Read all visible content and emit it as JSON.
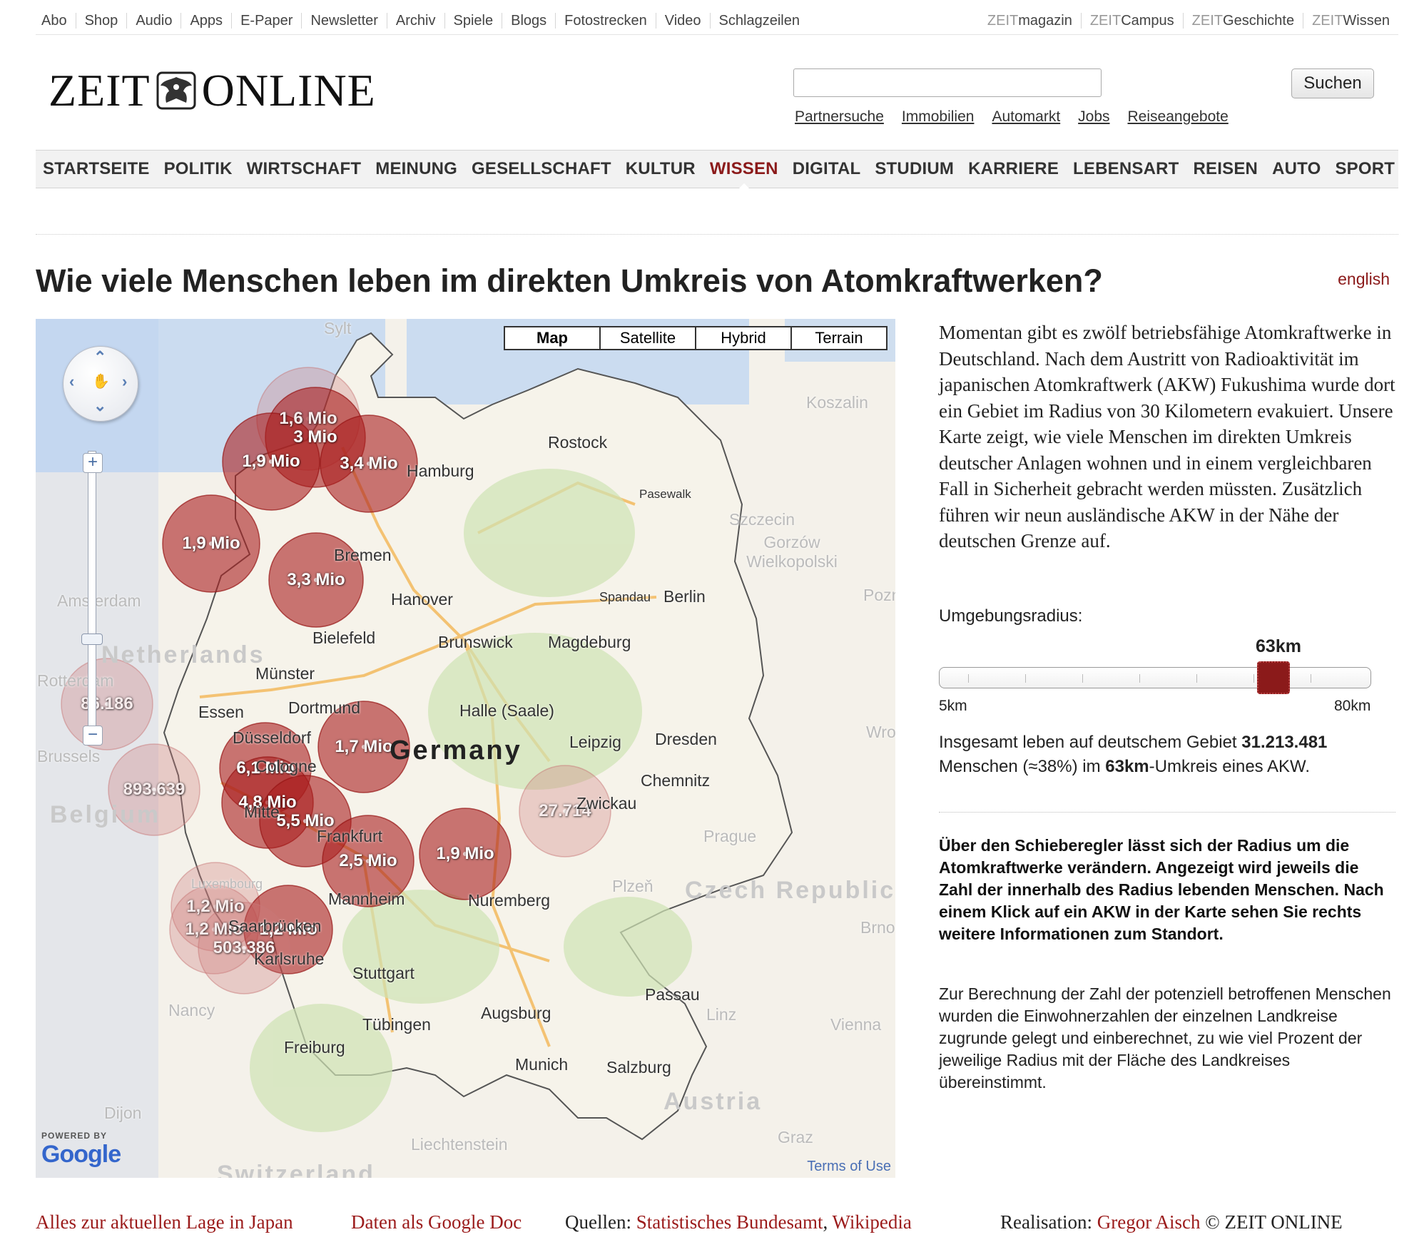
{
  "topbar": {
    "left": [
      "Abo",
      "Shop",
      "Audio",
      "Apps",
      "E-Paper",
      "Newsletter",
      "Archiv",
      "Spiele",
      "Blogs",
      "Fotostrecken",
      "Video",
      "Schlagzeilen"
    ],
    "right": [
      {
        "prefix": "ZEIT",
        "name": "magazin"
      },
      {
        "prefix": "ZEIT",
        "name": "Campus"
      },
      {
        "prefix": "ZEIT",
        "name": "Geschichte"
      },
      {
        "prefix": "ZEIT",
        "name": "Wissen"
      }
    ]
  },
  "logo": {
    "left": "ZEIT",
    "right": "ONLINE"
  },
  "search": {
    "value": "",
    "button": "Suchen"
  },
  "service_links": [
    "Partnersuche",
    "Immobilien",
    "Automarkt",
    "Jobs",
    "Reiseangebote"
  ],
  "nav": {
    "items": [
      "STARTSEITE",
      "POLITIK",
      "WIRTSCHAFT",
      "MEINUNG",
      "GESELLSCHAFT",
      "KULTUR",
      "WISSEN",
      "DIGITAL",
      "STUDIUM",
      "KARRIERE",
      "LEBENSART",
      "REISEN",
      "AUTO",
      "SPORT"
    ],
    "active": "WISSEN"
  },
  "headline": "Wie viele Menschen leben im direkten Umkreis von Atomkraftwerken?",
  "lang_link": "english",
  "map": {
    "types": [
      "Map",
      "Satellite",
      "Hybrid",
      "Terrain"
    ],
    "selected_type": "Map",
    "country_label": "Germany",
    "terms": "Terms of Use",
    "powered_by": "POWERED BY",
    "google": "Google",
    "circles": [
      {
        "label": "1,6 Mio",
        "domestic": false
      },
      {
        "label": "3 Mio",
        "domestic": true
      },
      {
        "label": "1,9 Mio",
        "domestic": true
      },
      {
        "label": "3,4 Mio",
        "domestic": true
      },
      {
        "label": "1,9 Mio",
        "domestic": true
      },
      {
        "label": "3,3 Mio",
        "domestic": true
      },
      {
        "label": "86.186",
        "domestic": false
      },
      {
        "label": "1,7 Mio",
        "domestic": true
      },
      {
        "label": "6,1 Mio",
        "domestic": true
      },
      {
        "label": "893.639",
        "domestic": false
      },
      {
        "label": "4,8 Mio",
        "domestic": true
      },
      {
        "label": "5,5 Mio",
        "domestic": true
      },
      {
        "label": "27.714",
        "domestic": false
      },
      {
        "label": "2,5 Mio",
        "domestic": true
      },
      {
        "label": "1,9 Mio",
        "domestic": true
      },
      {
        "label": "1,2 Mio",
        "domestic": false
      },
      {
        "label": "1,2 Mio",
        "domestic": false
      },
      {
        "label": "1,2 Mio",
        "domestic": true
      },
      {
        "label": "503.386",
        "domestic": false
      }
    ],
    "cities": [
      "Rostock",
      "Hamburg",
      "Bremen",
      "Hanover",
      "Berlin",
      "Magdeburg",
      "Bielefeld",
      "Brunswick",
      "Münster",
      "Dortmund",
      "Essen",
      "Düsseldorf",
      "Cologne",
      "Halle (Saale)",
      "Leipzig",
      "Dresden",
      "Chemnitz",
      "Zwickau",
      "Frankfurt",
      "Mannheim",
      "Nuremberg",
      "Saarbrücken",
      "Karlsruhe",
      "Stuttgart",
      "Tübingen",
      "Augsburg",
      "Munich",
      "Freiburg",
      "Salzburg",
      "Passau",
      "Mitte",
      "Pasewalk",
      "Spandau"
    ],
    "faint_labels": [
      "Sylt",
      "Koszalin",
      "Szczecin",
      "Gorzów Wielkopolski",
      "Amsterdam",
      "Rotterdam",
      "Brussels",
      "Prague",
      "Plzeň",
      "Linz",
      "Vienna",
      "Brno",
      "Graz",
      "Dijon",
      "Nancy",
      "Liechtenstein",
      "Luxembourg",
      "Wrocław",
      "Poznań",
      "Netherlands",
      "Czech Republic",
      "Austria",
      "Belgium",
      "Switzerland"
    ]
  },
  "intro": "Momentan gibt es zwölf betriebsfähige Atomkraftwerke in Deutschland. Nach dem Austritt von Radioaktivität im japanischen Atomkraftwerk (AKW) Fukushima wurde dort ein Gebiet im Radius von 30 Kilometern evakuiert. Unsere Karte zeigt, wie viele Menschen im direkten Umkreis deutscher Anlagen wohnen und in einem vergleichbaren Fall in Sicherheit gebracht werden müssten. Zusätzlich führen wir neun ausländische AKW in der Nähe der deutschen Grenze auf.",
  "slider": {
    "label": "Umgebungsradius:",
    "value": "63km",
    "value_km": 63,
    "min": "5km",
    "max": "80km"
  },
  "summary": {
    "part1": "Insgesamt leben auf deutschem Gebiet ",
    "total": "31.213.481",
    "part2": " Menschen (≈38%) im ",
    "radius": "63km",
    "part3": "-Umkreis eines AKW."
  },
  "howto": "Über den Schieberegler lässt sich der Radius um die Atomkraftwerke verändern. Angezeigt wird jeweils die Zahl der innerhalb des Radius lebenden Menschen. Nach einem Klick auf ein AKW in der Karte sehen Sie rechts weitere Informationen zum Standort.",
  "method": "Zur Berechnung der Zahl der potenziell betroffenen Menschen wurden die Einwohnerzahlen der einzelnen Landkreise zugrunde gelegt und einberechnet, zu wie viel Prozent der jeweilige Radius mit der Fläche des Landkreises übereinstimmt.",
  "footer": {
    "japan_link": "Alles zur aktuellen Lage in Japan",
    "gdoc_link": "Daten als Google Doc",
    "sources_label": "Quellen: ",
    "source1": "Statistisches Bundesamt",
    "comma": ", ",
    "source2": "Wikipedia",
    "credit_label": "Realisation: ",
    "author": "Gregor Aisch",
    "copyright": " © ZEIT ONLINE"
  }
}
